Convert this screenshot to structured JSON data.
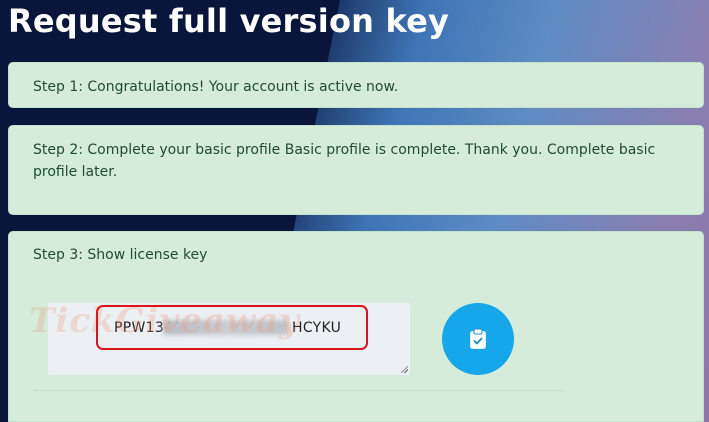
{
  "page": {
    "title": "Request full version key"
  },
  "steps": [
    {
      "label": "Step 1: Congratulations! Your account is active now."
    },
    {
      "label": "Step 2: Complete your basic profile Basic profile is complete. Thank you. Complete basic profile later."
    },
    {
      "label": "Step 3: Show license key"
    }
  ],
  "license": {
    "key_prefix": "PPW13-V",
    "key_suffix": "HCYKU",
    "copy_icon": "clipboard-check-icon"
  },
  "watermark": {
    "text": "TickGiveaway"
  },
  "colors": {
    "card_bg": "#d5ecdb",
    "card_text": "#1f4d2e",
    "copy_button": "#15a7ea",
    "highlight": "#d8161c"
  }
}
